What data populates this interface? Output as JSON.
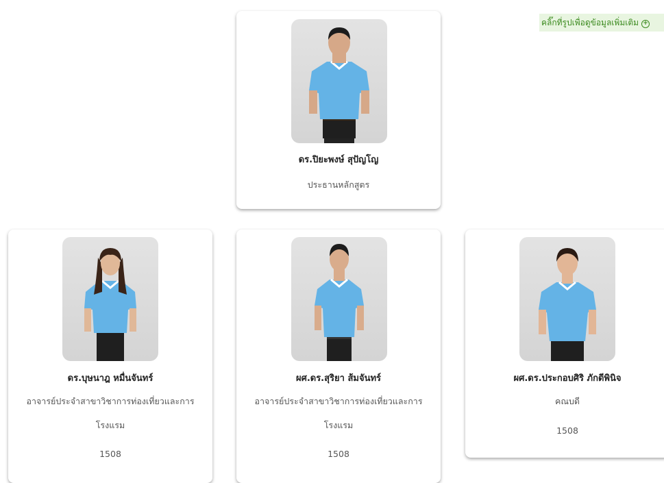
{
  "hint": {
    "text": "คลิ๊กที่รูปเพื่อดูข้อมูลเพิ่มเติม",
    "icon": "plus-circle-icon"
  },
  "colors": {
    "shirt": "#64b3e6",
    "hint_bg": "#e8f5e0",
    "hint_text": "#3b8a1e"
  },
  "people": [
    {
      "name": "ดร.ปิยะพงษ์ สุปัญโญ",
      "role": "ประธานหลักสูตร"
    },
    {
      "name": "ดร.บุษนาฎ หมื่นจันทร์",
      "role_line1": "อาจารย์ประจำสาขาวิชาการท่องเที่ยวและการ",
      "role_line2": "โรงแรม",
      "room": "1508"
    },
    {
      "name": "ผศ.ดร.สุริยา ส้มจันทร์",
      "role_line1": "อาจารย์ประจำสาขาวิชาการท่องเที่ยวและการ",
      "role_line2": "โรงแรม",
      "room": "1508"
    },
    {
      "name": "ผศ.ดร.ประกอบศิริ ภักดีพินิจ",
      "role": "คณบดี",
      "room": "1508"
    }
  ]
}
